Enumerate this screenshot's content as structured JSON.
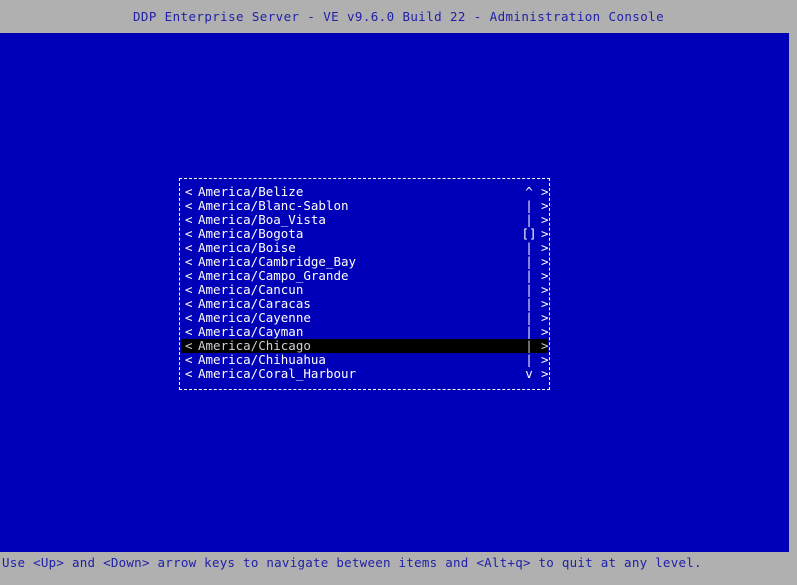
{
  "window": {
    "title": "DDP Enterprise Server - VE v9.6.0 Build 22 - Administration Console"
  },
  "colors": {
    "chrome_background": "#b0b0b0",
    "chrome_text": "#2020a8",
    "console_background": "#0000b8",
    "console_text": "#ffffff",
    "selection_background": "#000000",
    "selection_text": "#d0d0d0",
    "dialog_border": "#ffffff"
  },
  "statusbar": {
    "hint": "Use <Up> and <Down> arrow keys to navigate between items and <Alt+q> to quit at any level."
  },
  "dialog": {
    "name": "timezone-selection-list",
    "left_marker": "<",
    "right_marker": ">",
    "scroll_markers": {
      "up": "^",
      "track": "|",
      "thumb": "[]",
      "down": "v"
    },
    "selected_index": 11,
    "items": [
      {
        "label": "America/Belize",
        "scroll": "^",
        "selected": false
      },
      {
        "label": "America/Blanc-Sablon",
        "scroll": "|",
        "selected": false
      },
      {
        "label": "America/Boa_Vista",
        "scroll": "|",
        "selected": false
      },
      {
        "label": "America/Bogota",
        "scroll": "[]",
        "selected": false
      },
      {
        "label": "America/Boise",
        "scroll": "|",
        "selected": false
      },
      {
        "label": "America/Cambridge_Bay",
        "scroll": "|",
        "selected": false
      },
      {
        "label": "America/Campo_Grande",
        "scroll": "|",
        "selected": false
      },
      {
        "label": "America/Cancun",
        "scroll": "|",
        "selected": false
      },
      {
        "label": "America/Caracas",
        "scroll": "|",
        "selected": false
      },
      {
        "label": "America/Cayenne",
        "scroll": "|",
        "selected": false
      },
      {
        "label": "America/Cayman",
        "scroll": "|",
        "selected": false
      },
      {
        "label": "America/Chicago",
        "scroll": "|",
        "selected": true
      },
      {
        "label": "America/Chihuahua",
        "scroll": "|",
        "selected": false
      },
      {
        "label": "America/Coral_Harbour",
        "scroll": "v",
        "selected": false
      }
    ]
  }
}
